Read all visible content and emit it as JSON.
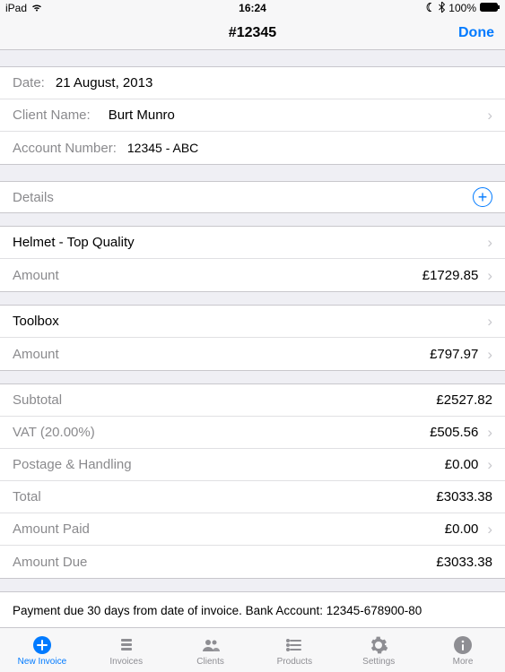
{
  "status_bar": {
    "device": "iPad",
    "time": "16:24",
    "battery": "100%"
  },
  "nav": {
    "title": "#12345",
    "done": "Done"
  },
  "header": {
    "date_label": "Date:",
    "date_value": "21 August, 2013",
    "client_label": "Client Name:",
    "client_value": "Burt Munro",
    "account_label": "Account Number:",
    "account_value": "12345 - ABC"
  },
  "details": {
    "heading": "Details",
    "items": [
      {
        "name_label": "Helmet - Top Quality",
        "amount_label": "Amount",
        "amount_value": "£1729.85"
      },
      {
        "name_label": "Toolbox",
        "amount_label": "Amount",
        "amount_value": "£797.97"
      }
    ]
  },
  "totals": {
    "subtotal_label": "Subtotal",
    "subtotal_value": "£2527.82",
    "vat_label": "VAT (20.00%)",
    "vat_value": "£505.56",
    "postage_label": "Postage & Handling",
    "postage_value": "£0.00",
    "total_label": "Total",
    "total_value": "£3033.38",
    "paid_label": "Amount Paid",
    "paid_value": "£0.00",
    "due_label": "Amount Due",
    "due_value": "£3033.38"
  },
  "footer_note": "Payment due 30 days from date of invoice.  Bank Account:  12345-678900-80",
  "tabs": [
    {
      "label": "New Invoice",
      "icon": "plus-circle-icon",
      "active": true
    },
    {
      "label": "Invoices",
      "icon": "stack-icon",
      "active": false
    },
    {
      "label": "Clients",
      "icon": "people-icon",
      "active": false
    },
    {
      "label": "Products",
      "icon": "list-icon",
      "active": false
    },
    {
      "label": "Settings",
      "icon": "gear-icon",
      "active": false
    },
    {
      "label": "More",
      "icon": "info-icon",
      "active": false
    }
  ]
}
